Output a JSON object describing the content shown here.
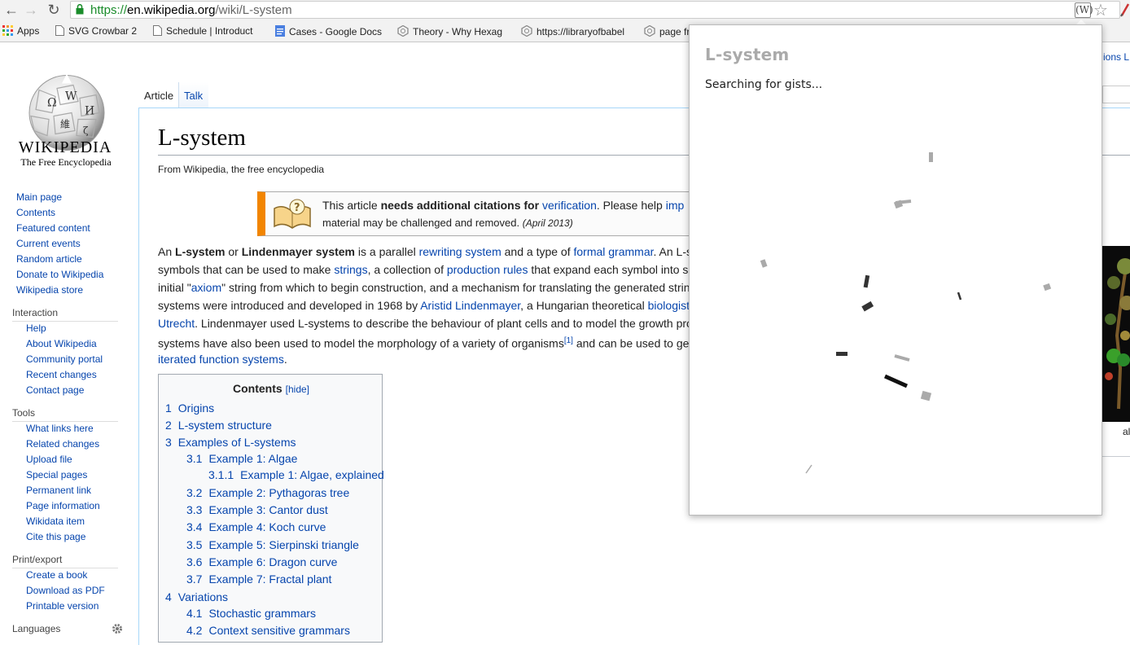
{
  "browser": {
    "url_scheme": "https://",
    "url_host": "en.wikipedia.org",
    "url_path": "/wiki/L-system",
    "extension_icon_label": "(W)",
    "bookmarks": [
      "Apps",
      "SVG Crowbar 2",
      "Schedule | Introduct",
      "Cases - Google Docs",
      "Theory - Why Hexag",
      "https://libraryofbabel",
      "page fr"
    ]
  },
  "wiki": {
    "wordmark": "WIKIPEDIA",
    "tagline": "The Free Encyclopedia",
    "nav": [
      "Main page",
      "Contents",
      "Featured content",
      "Current events",
      "Random article",
      "Donate to Wikipedia",
      "Wikipedia store"
    ],
    "interaction_heading": "Interaction",
    "interaction": [
      "Help",
      "About Wikipedia",
      "Community portal",
      "Recent changes",
      "Contact page"
    ],
    "tools_heading": "Tools",
    "tools": [
      "What links here",
      "Related changes",
      "Upload file",
      "Special pages",
      "Permanent link",
      "Page information",
      "Wikidata item",
      "Cite this page"
    ],
    "print_heading": "Print/export",
    "print": [
      "Create a book",
      "Download as PDF",
      "Printable version"
    ],
    "languages_heading": "Languages",
    "tab_article": "Article",
    "tab_talk": "Talk",
    "right_tabs": "ions  L",
    "title": "L-system",
    "from": "From Wikipedia, the free encyclopedia",
    "ambox": {
      "pre": "This article ",
      "bold": "needs additional citations for ",
      "link": "verification",
      "post": ". Please help ",
      "link2": "imp",
      "line2": "material may be challenged and removed. ",
      "date": "(April 2013)"
    },
    "right_caption": "al",
    "toc": {
      "title": "Contents",
      "hide": "[hide]",
      "items": [
        {
          "num": "1",
          "text": "Origins"
        },
        {
          "num": "2",
          "text": "L-system structure"
        },
        {
          "num": "3",
          "text": "Examples of L-systems"
        },
        {
          "num": "3.1",
          "text": "Example 1: Algae"
        },
        {
          "num": "3.1.1",
          "text": "Example 1: Algae, explained"
        },
        {
          "num": "3.2",
          "text": "Example 2: Pythagoras tree"
        },
        {
          "num": "3.3",
          "text": "Example 3: Cantor dust"
        },
        {
          "num": "3.4",
          "text": "Example 4: Koch curve"
        },
        {
          "num": "3.5",
          "text": "Example 5: Sierpinski triangle"
        },
        {
          "num": "3.6",
          "text": "Example 6: Dragon curve"
        },
        {
          "num": "3.7",
          "text": "Example 7: Fractal plant"
        },
        {
          "num": "4",
          "text": "Variations"
        },
        {
          "num": "4.1",
          "text": "Stochastic grammars"
        },
        {
          "num": "4.2",
          "text": "Context sensitive grammars"
        }
      ]
    }
  },
  "popup": {
    "title": "L-system",
    "status": "Searching for gists..."
  }
}
